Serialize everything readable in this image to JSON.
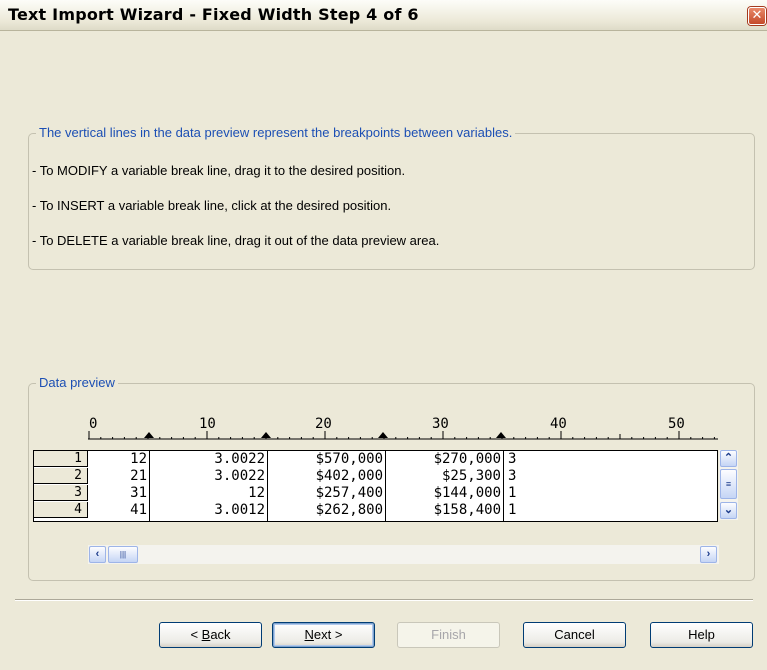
{
  "window": {
    "title": "Text Import Wizard - Fixed Width Step 4 of 6",
    "close_glyph": "✕"
  },
  "instructions": {
    "legend": "The vertical lines in the data preview represent the breakpoints between variables.",
    "lines": [
      "- To MODIFY a variable break line, drag it to the desired position.",
      "- To INSERT a variable break line, click at the desired position.",
      "- To DELETE a variable break line, drag it out of the data preview area."
    ]
  },
  "preview": {
    "legend": "Data preview",
    "ruler_labels": [
      "0",
      "10",
      "20",
      "30",
      "40",
      "50"
    ],
    "rows": [
      {
        "num": "1",
        "cells": [
          "12",
          "3.0022",
          "$570,000",
          "$270,000",
          "3"
        ]
      },
      {
        "num": "2",
        "cells": [
          "21",
          "3.0022",
          "$402,000",
          "$25,300",
          "3"
        ]
      },
      {
        "num": "3",
        "cells": [
          "31",
          "12",
          "$257,400",
          "$144,000",
          "1"
        ]
      },
      {
        "num": "4",
        "cells": [
          "41",
          "3.0012",
          "$262,800",
          "$158,400",
          "1"
        ]
      }
    ]
  },
  "buttons": {
    "back": {
      "pre": "< ",
      "accel": "B",
      "post": "ack"
    },
    "next": {
      "accel": "N",
      "post": "ext >"
    },
    "finish": "Finish",
    "cancel": "Cancel",
    "help": "Help"
  }
}
